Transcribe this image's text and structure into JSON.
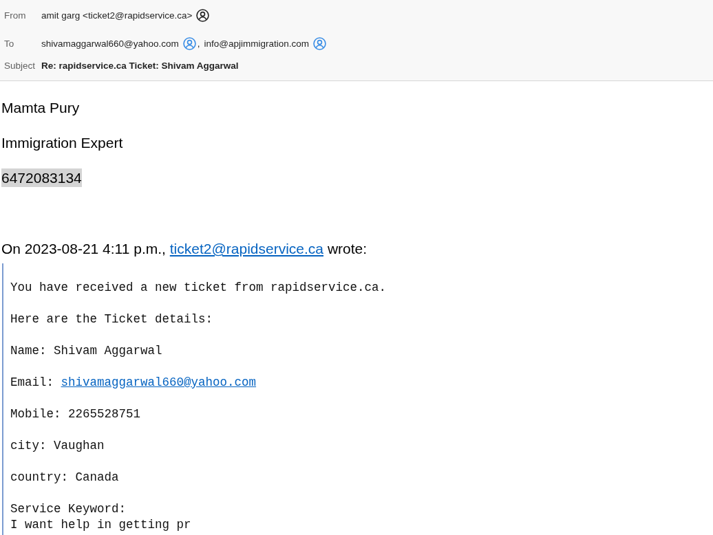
{
  "header": {
    "from": {
      "label": "From",
      "sender": "amit garg <ticket2@rapidservice.ca>"
    },
    "to": {
      "label": "To",
      "recipients": [
        "shivamaggarwal660@yahoo.com",
        "info@apjimmigration.com"
      ],
      "separator": ","
    },
    "subject": {
      "label": "Subject",
      "text": "Re: rapidservice.ca Ticket: Shivam Aggarwal"
    }
  },
  "body": {
    "signature": [
      {
        "text": "Mamta Pury",
        "highlighted": false
      },
      {
        "text": "Immigration Expert",
        "highlighted": false
      },
      {
        "text": "6472083134",
        "highlighted": true
      }
    ],
    "attribution": {
      "before": "On 2023-08-21 4:11 p.m.,",
      "link": "ticket2@rapidservice.ca",
      "after": "wrote:"
    },
    "quote": [
      {
        "kind": "text",
        "lines": [
          "You have received a new ticket from rapidservice.ca."
        ]
      },
      {
        "kind": "text",
        "lines": [
          "Here are the Ticket details:"
        ]
      },
      {
        "kind": "text",
        "lines": [
          "Name: Shivam Aggarwal"
        ]
      },
      {
        "kind": "link",
        "label": "Email:",
        "link": "shivamaggarwal660@yahoo.com"
      },
      {
        "kind": "text",
        "lines": [
          "Mobile: 2265528751"
        ]
      },
      {
        "kind": "text",
        "lines": [
          "city: Vaughan"
        ]
      },
      {
        "kind": "text",
        "lines": [
          "country: Canada"
        ]
      },
      {
        "kind": "text",
        "lines": [
          "Service Keyword:",
          "I want help in getting pr"
        ]
      }
    ]
  }
}
